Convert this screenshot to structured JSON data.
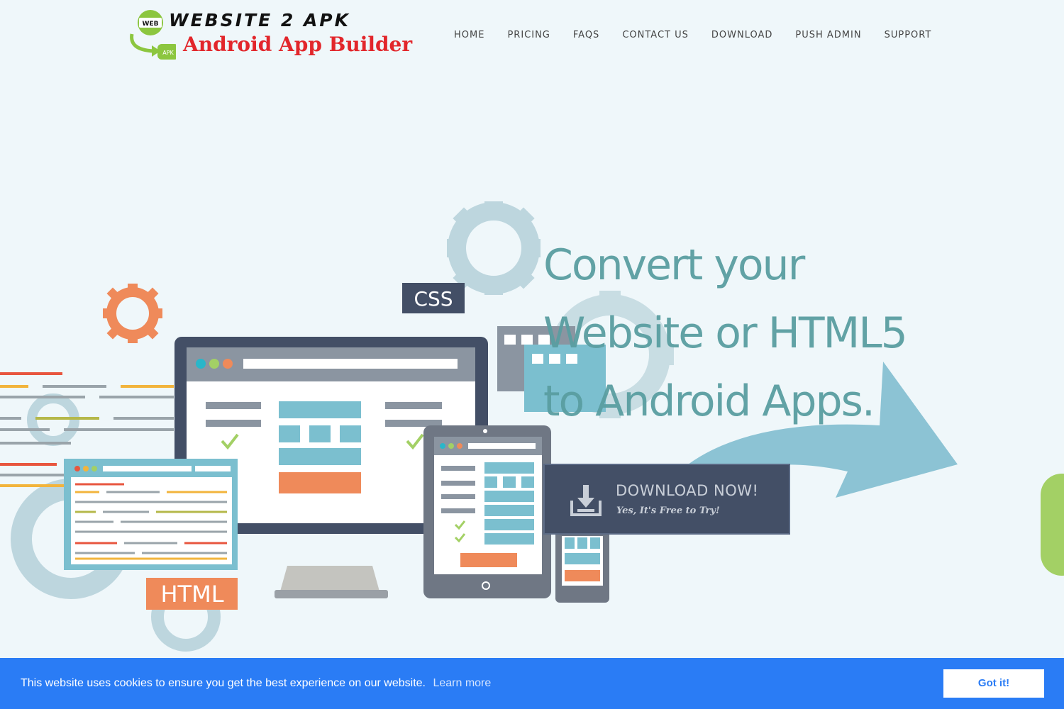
{
  "logo": {
    "line1": "WEBSITE 2 APK",
    "line2": "Android App Builder",
    "badge_web": "WEB",
    "badge_apk": "APK"
  },
  "nav": {
    "items": [
      {
        "label": "HOME"
      },
      {
        "label": "PRICING"
      },
      {
        "label": "FAQS"
      },
      {
        "label": "CONTACT US"
      },
      {
        "label": "DOWNLOAD"
      },
      {
        "label": "PUSH ADMIN"
      },
      {
        "label": "SUPPORT"
      }
    ]
  },
  "hero": {
    "headline_lines": [
      "Convert your",
      "Website or HTML5",
      "to Android Apps."
    ],
    "css_label": "CSS",
    "html_label": "HTML",
    "download_button": {
      "title": "DOWNLOAD NOW!",
      "subtitle": "Yes, It's Free to Try!",
      "icon": "download-tray-icon"
    }
  },
  "cookie_bar": {
    "message": "This website uses cookies to ensure you get the best experience on our website.",
    "learn_more": "Learn more",
    "accept": "Got it!"
  },
  "colors": {
    "background": "#eff7fa",
    "headline": "#5a9ea1",
    "logo_red": "#e2262b",
    "button_dark": "#434f66",
    "cookie_bar": "#2a7cf5",
    "side_tab": "#a3d065",
    "gear_blue": "#bdd6de",
    "gear_orange": "#ef8a5a",
    "accent_teal": "#7bbfcf"
  }
}
